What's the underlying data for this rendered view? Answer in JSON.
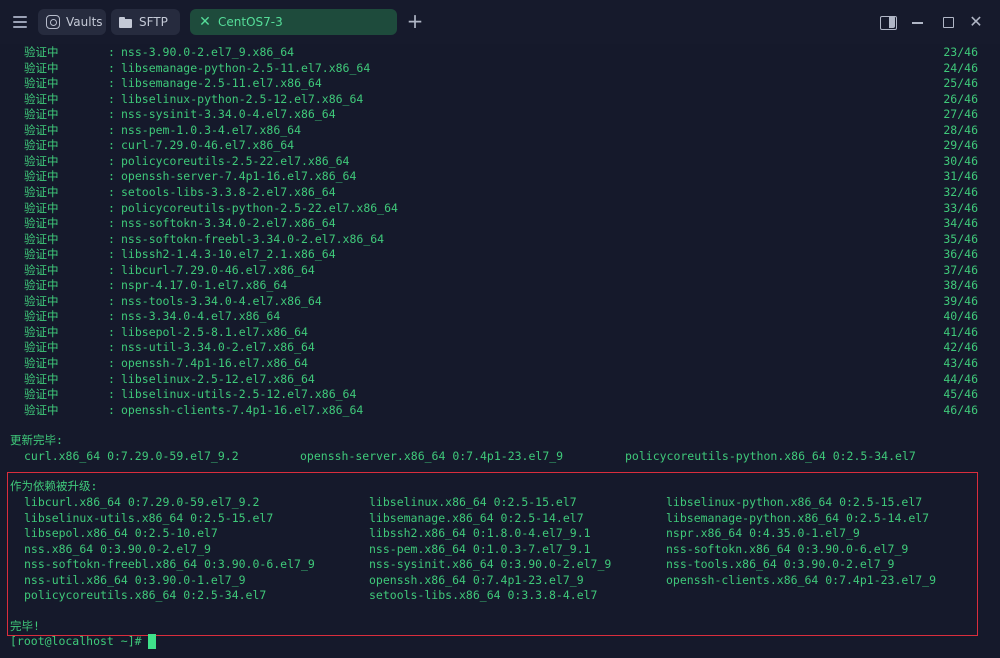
{
  "tabs": [
    {
      "label": "Vaults",
      "icon": "vault-icon"
    },
    {
      "label": "SFTP",
      "icon": "folder-icon"
    },
    {
      "label": "CentOS7-3",
      "icon": "close-x-icon",
      "active": true
    }
  ],
  "new_tab_label": "+",
  "colors": {
    "text": "#3fc97a",
    "background": "#15192b",
    "active_tab": "#1e4b3c",
    "highlight_border": "#d92d3d"
  },
  "terminal": {
    "verify_rows": [
      {
        "status": "验证中",
        "sep": ":",
        "package": "nss-3.90.0-2.el7_9.x86_64",
        "count": "23/46"
      },
      {
        "status": "验证中",
        "sep": ":",
        "package": "libsemanage-python-2.5-11.el7.x86_64",
        "count": "24/46"
      },
      {
        "status": "验证中",
        "sep": ":",
        "package": "libsemanage-2.5-11.el7.x86_64",
        "count": "25/46"
      },
      {
        "status": "验证中",
        "sep": ":",
        "package": "libselinux-python-2.5-12.el7.x86_64",
        "count": "26/46"
      },
      {
        "status": "验证中",
        "sep": ":",
        "package": "nss-sysinit-3.34.0-4.el7.x86_64",
        "count": "27/46"
      },
      {
        "status": "验证中",
        "sep": ":",
        "package": "nss-pem-1.0.3-4.el7.x86_64",
        "count": "28/46"
      },
      {
        "status": "验证中",
        "sep": ":",
        "package": "curl-7.29.0-46.el7.x86_64",
        "count": "29/46"
      },
      {
        "status": "验证中",
        "sep": ":",
        "package": "policycoreutils-2.5-22.el7.x86_64",
        "count": "30/46"
      },
      {
        "status": "验证中",
        "sep": ":",
        "package": "openssh-server-7.4p1-16.el7.x86_64",
        "count": "31/46"
      },
      {
        "status": "验证中",
        "sep": ":",
        "package": "setools-libs-3.3.8-2.el7.x86_64",
        "count": "32/46"
      },
      {
        "status": "验证中",
        "sep": ":",
        "package": "policycoreutils-python-2.5-22.el7.x86_64",
        "count": "33/46"
      },
      {
        "status": "验证中",
        "sep": ":",
        "package": "nss-softokn-3.34.0-2.el7.x86_64",
        "count": "34/46"
      },
      {
        "status": "验证中",
        "sep": ":",
        "package": "nss-softokn-freebl-3.34.0-2.el7.x86_64",
        "count": "35/46"
      },
      {
        "status": "验证中",
        "sep": ":",
        "package": "libssh2-1.4.3-10.el7_2.1.x86_64",
        "count": "36/46"
      },
      {
        "status": "验证中",
        "sep": ":",
        "package": "libcurl-7.29.0-46.el7.x86_64",
        "count": "37/46"
      },
      {
        "status": "验证中",
        "sep": ":",
        "package": "nspr-4.17.0-1.el7.x86_64",
        "count": "38/46"
      },
      {
        "status": "验证中",
        "sep": ":",
        "package": "nss-tools-3.34.0-4.el7.x86_64",
        "count": "39/46"
      },
      {
        "status": "验证中",
        "sep": ":",
        "package": "nss-3.34.0-4.el7.x86_64",
        "count": "40/46"
      },
      {
        "status": "验证中",
        "sep": ":",
        "package": "libsepol-2.5-8.1.el7.x86_64",
        "count": "41/46"
      },
      {
        "status": "验证中",
        "sep": ":",
        "package": "nss-util-3.34.0-2.el7.x86_64",
        "count": "42/46"
      },
      {
        "status": "验证中",
        "sep": ":",
        "package": "openssh-7.4p1-16.el7.x86_64",
        "count": "43/46"
      },
      {
        "status": "验证中",
        "sep": ":",
        "package": "libselinux-2.5-12.el7.x86_64",
        "count": "44/46"
      },
      {
        "status": "验证中",
        "sep": ":",
        "package": "libselinux-utils-2.5-12.el7.x86_64",
        "count": "45/46"
      },
      {
        "status": "验证中",
        "sep": ":",
        "package": "openssh-clients-7.4p1-16.el7.x86_64",
        "count": "46/46"
      }
    ],
    "updated_heading": "更新完毕:",
    "updated": [
      "curl.x86_64 0:7.29.0-59.el7_9.2",
      "openssh-server.x86_64 0:7.4p1-23.el7_9",
      "policycoreutils-python.x86_64 0:2.5-34.el7"
    ],
    "dependency_heading": "作为依赖被升级:",
    "dependencies": [
      [
        "libcurl.x86_64 0:7.29.0-59.el7_9.2",
        "libselinux.x86_64 0:2.5-15.el7",
        "libselinux-python.x86_64 0:2.5-15.el7"
      ],
      [
        "libselinux-utils.x86_64 0:2.5-15.el7",
        "libsemanage.x86_64 0:2.5-14.el7",
        "libsemanage-python.x86_64 0:2.5-14.el7"
      ],
      [
        "libsepol.x86_64 0:2.5-10.el7",
        "libssh2.x86_64 0:1.8.0-4.el7_9.1",
        "nspr.x86_64 0:4.35.0-1.el7_9"
      ],
      [
        "nss.x86_64 0:3.90.0-2.el7_9",
        "nss-pem.x86_64 0:1.0.3-7.el7_9.1",
        "nss-softokn.x86_64 0:3.90.0-6.el7_9"
      ],
      [
        "nss-softokn-freebl.x86_64 0:3.90.0-6.el7_9",
        "nss-sysinit.x86_64 0:3.90.0-2.el7_9",
        "nss-tools.x86_64 0:3.90.0-2.el7_9"
      ],
      [
        "nss-util.x86_64 0:3.90.0-1.el7_9",
        "openssh.x86_64 0:7.4p1-23.el7_9",
        "openssh-clients.x86_64 0:7.4p1-23.el7_9"
      ],
      [
        "policycoreutils.x86_64 0:2.5-34.el7",
        "setools-libs.x86_64 0:3.3.8-4.el7",
        ""
      ]
    ],
    "complete": "完毕!",
    "prompt": "[root@localhost ~]#"
  }
}
